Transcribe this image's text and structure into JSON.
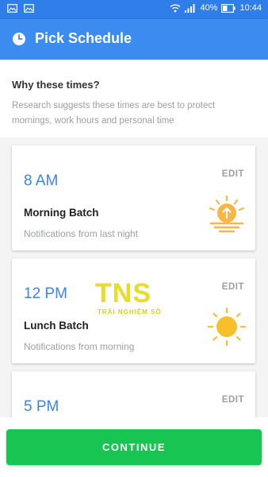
{
  "status_bar": {
    "battery": "40%",
    "time": "10:44",
    "icons": [
      "image-icon",
      "image-icon",
      "wifi-icon",
      "signal-icon",
      "battery-icon"
    ]
  },
  "app_bar": {
    "title": "Pick Schedule",
    "icon": "clock-icon"
  },
  "intro": {
    "title": "Why these times?",
    "text": "Research suggests these times are best to protect mornings, work hours and personal time"
  },
  "batches": [
    {
      "time": "8 AM",
      "edit_label": "EDIT",
      "name": "Morning Batch",
      "description": "Notifications from last night",
      "icon": "sunrise-icon"
    },
    {
      "time": "12 PM",
      "edit_label": "EDIT",
      "name": "Lunch Batch",
      "description": "Notifications from morning",
      "icon": "sun-icon"
    },
    {
      "time": "5 PM",
      "edit_label": "EDIT"
    }
  ],
  "watermark": {
    "logo": "TNS",
    "subtitle": "TRẢI NGHIỆM SỐ"
  },
  "footer": {
    "continue_label": "CONTINUE"
  },
  "colors": {
    "app_bar": "#3b8bf0",
    "time_text": "#3a86e5",
    "continue_button": "#18c452",
    "sun": "#f7c02b"
  }
}
